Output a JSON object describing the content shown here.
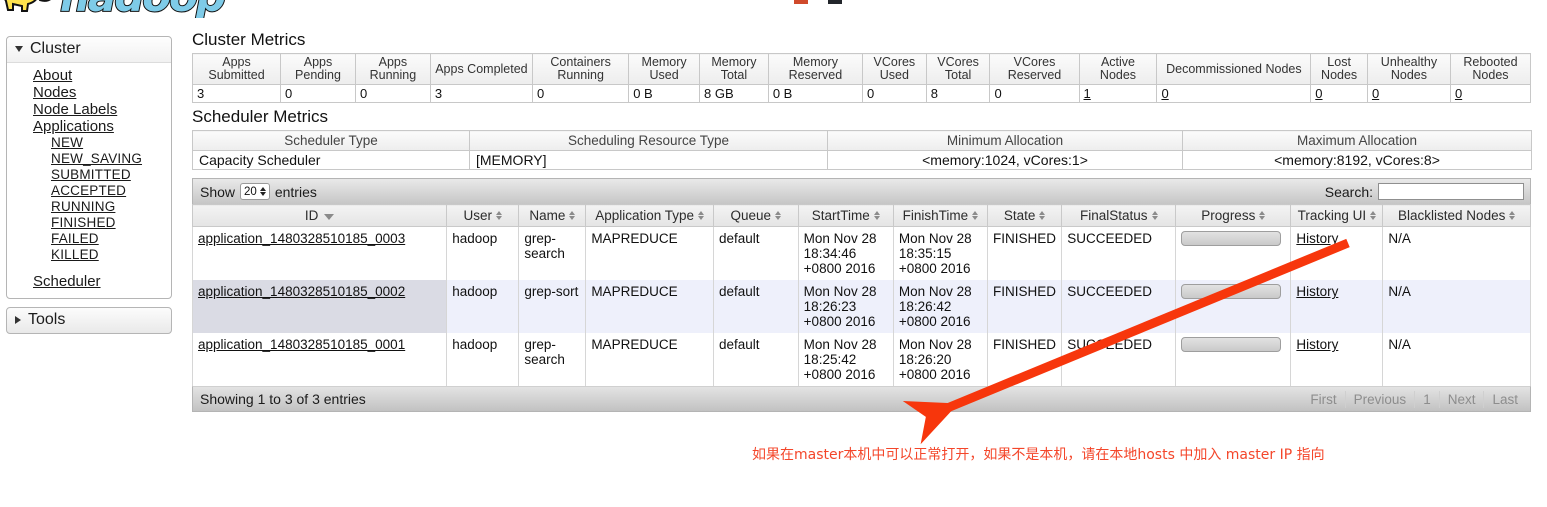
{
  "branding": {
    "logo_text": "hadoop",
    "logo_icon": "hadoop-elephant-logo"
  },
  "sidebar": {
    "cluster": {
      "label": "Cluster",
      "expanded": true,
      "items": [
        {
          "label": "About"
        },
        {
          "label": "Nodes"
        },
        {
          "label": "Node Labels"
        },
        {
          "label": "Applications"
        }
      ],
      "application_states": [
        {
          "label": "NEW"
        },
        {
          "label": "NEW_SAVING"
        },
        {
          "label": "SUBMITTED"
        },
        {
          "label": "ACCEPTED"
        },
        {
          "label": "RUNNING"
        },
        {
          "label": "FINISHED"
        },
        {
          "label": "FAILED"
        },
        {
          "label": "KILLED"
        }
      ],
      "scheduler_link": "Scheduler"
    },
    "tools": {
      "label": "Tools",
      "expanded": false
    }
  },
  "cluster_metrics": {
    "title": "Cluster Metrics",
    "columns": [
      "Apps Submitted",
      "Apps Pending",
      "Apps Running",
      "Apps Completed",
      "Containers Running",
      "Memory Used",
      "Memory Total",
      "Memory Reserved",
      "VCores Used",
      "VCores Total",
      "VCores Reserved",
      "Active Nodes",
      "Decommissioned Nodes",
      "Lost Nodes",
      "Unhealthy Nodes",
      "Rebooted Nodes"
    ],
    "values": [
      "3",
      "0",
      "0",
      "3",
      "0",
      "0 B",
      "8 GB",
      "0 B",
      "0",
      "8",
      "0",
      "1",
      "0",
      "0",
      "0",
      "0"
    ],
    "link_flags": [
      false,
      false,
      false,
      false,
      false,
      false,
      false,
      false,
      false,
      false,
      false,
      true,
      true,
      true,
      true,
      true
    ]
  },
  "scheduler_metrics": {
    "title": "Scheduler Metrics",
    "columns": [
      "Scheduler Type",
      "Scheduling Resource Type",
      "Minimum Allocation",
      "Maximum Allocation"
    ],
    "values": [
      "Capacity Scheduler",
      "[MEMORY]",
      "<memory:1024, vCores:1>",
      "<memory:8192, vCores:8>"
    ]
  },
  "apps_table": {
    "show_label": "Show",
    "entries_label": "entries",
    "page_size": "20",
    "search_label": "Search:",
    "search_value": "",
    "search_placeholder": "",
    "columns": [
      {
        "label": "ID",
        "sort": "desc"
      },
      {
        "label": "User",
        "sort": "both"
      },
      {
        "label": "Name",
        "sort": "both"
      },
      {
        "label": "Application Type",
        "sort": "both"
      },
      {
        "label": "Queue",
        "sort": "both"
      },
      {
        "label": "StartTime",
        "sort": "both"
      },
      {
        "label": "FinishTime",
        "sort": "both"
      },
      {
        "label": "State",
        "sort": "both"
      },
      {
        "label": "FinalStatus",
        "sort": "both"
      },
      {
        "label": "Progress",
        "sort": "both"
      },
      {
        "label": "Tracking UI",
        "sort": "both"
      },
      {
        "label": "Blacklisted Nodes",
        "sort": "both"
      }
    ],
    "rows": [
      {
        "id": "application_1480328510185_0003",
        "user": "hadoop",
        "name": "grep-search",
        "app_type": "MAPREDUCE",
        "queue": "default",
        "start_time": "Mon Nov 28 18:34:46 +0800 2016",
        "finish_time": "Mon Nov 28 18:35:15 +0800 2016",
        "state": "FINISHED",
        "final_status": "SUCCEEDED",
        "progress": "0",
        "tracking_ui": "History",
        "blacklisted_nodes": "N/A",
        "highlighted": false
      },
      {
        "id": "application_1480328510185_0002",
        "user": "hadoop",
        "name": "grep-sort",
        "app_type": "MAPREDUCE",
        "queue": "default",
        "start_time": "Mon Nov 28 18:26:23 +0800 2016",
        "finish_time": "Mon Nov 28 18:26:42 +0800 2016",
        "state": "FINISHED",
        "final_status": "SUCCEEDED",
        "progress": "0",
        "tracking_ui": "History",
        "blacklisted_nodes": "N/A",
        "highlighted": true
      },
      {
        "id": "application_1480328510185_0001",
        "user": "hadoop",
        "name": "grep-search",
        "app_type": "MAPREDUCE",
        "queue": "default",
        "start_time": "Mon Nov 28 18:25:42 +0800 2016",
        "finish_time": "Mon Nov 28 18:26:20 +0800 2016",
        "state": "FINISHED",
        "final_status": "SUCCEEDED",
        "progress": "0",
        "tracking_ui": "History",
        "blacklisted_nodes": "N/A",
        "highlighted": false
      }
    ],
    "footer_info": "Showing 1 to 3 of 3 entries",
    "pagination": [
      "First",
      "Previous",
      "1",
      "Next",
      "Last"
    ]
  },
  "annotation": {
    "text": "如果在master本机中可以正常打开，如果不是本机，请在本地hosts 中加入 master IP 指向",
    "color": "#f4462a",
    "arrow_name": "red-annotation-arrow"
  }
}
